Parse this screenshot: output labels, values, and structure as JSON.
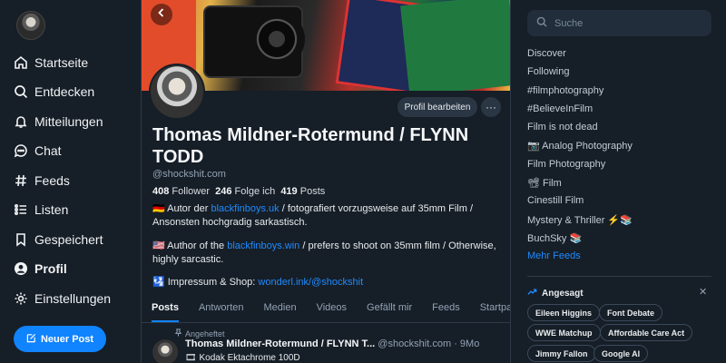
{
  "nav": {
    "items": [
      {
        "label": "Startseite",
        "icon": "home-icon"
      },
      {
        "label": "Entdecken",
        "icon": "search-icon"
      },
      {
        "label": "Mitteilungen",
        "icon": "bell-icon"
      },
      {
        "label": "Chat",
        "icon": "chat-icon"
      },
      {
        "label": "Feeds",
        "icon": "hash-icon"
      },
      {
        "label": "Listen",
        "icon": "list-icon"
      },
      {
        "label": "Gespeichert",
        "icon": "bookmark-icon"
      },
      {
        "label": "Profil",
        "icon": "profile-icon"
      },
      {
        "label": "Einstellungen",
        "icon": "gear-icon"
      }
    ],
    "new_post_label": "Neuer Post"
  },
  "profile": {
    "name": "Thomas Mildner-Rotermund / FLYNN TODD",
    "handle": "@shockshit.com",
    "edit_label": "Profil bearbeiten",
    "more_label": "···",
    "followers_count": "408",
    "followers_label": "Follower",
    "following_count": "246",
    "following_label": "Folge ich",
    "posts_count": "419",
    "posts_label": "Posts",
    "bio_de_prefix": "🇩🇪 Autor der ",
    "bio_de_link": "blackfinboys.uk",
    "bio_de_suffix": " / fotografiert vorzugsweise auf 35mm Film / Ansonsten hochgradig sarkastisch.",
    "bio_en_prefix": "🇺🇸 Author of the ",
    "bio_en_link": "blackfinboys.win",
    "bio_en_suffix": " / prefers to shoot on 35mm film / Otherwise, highly sarcastic.",
    "bio_shop_prefix": "🛂 Impressum & Shop: ",
    "bio_shop_link": "wonderl.ink/@shockshit"
  },
  "tabs": [
    "Posts",
    "Antworten",
    "Medien",
    "Videos",
    "Gefällt mir",
    "Feeds",
    "Startpakete"
  ],
  "pinned_post": {
    "pinned_label": "Angeheftet",
    "author": "Thomas Mildner-Rotermund / FLYNN T...",
    "handle": "@shockshit.com",
    "time": "· 9Mo",
    "text": "🎞 Kodak Ektachrome 100D"
  },
  "right": {
    "search_placeholder": "Suche",
    "feeds": [
      "Discover",
      "Following",
      "#filmphotography",
      "#BelieveInFilm",
      "Film is not dead",
      "📷 Analog Photography",
      "Film Photography",
      "📽 Film",
      "Cinestill Film",
      "Mystery & Thriller ⚡📚",
      "BuchSky 📚"
    ],
    "more_feeds": "Mehr Feeds",
    "trending_title": "Angesagt",
    "trending_close": "✕",
    "trending": [
      "Eileen Higgins",
      "Font Debate",
      "WWE Matchup",
      "Affordable Care Act",
      "Jimmy Fallon",
      "Google AI"
    ]
  },
  "colors": {
    "accent": "#1083fe",
    "link": "#208bfe",
    "background": "#161e27"
  }
}
